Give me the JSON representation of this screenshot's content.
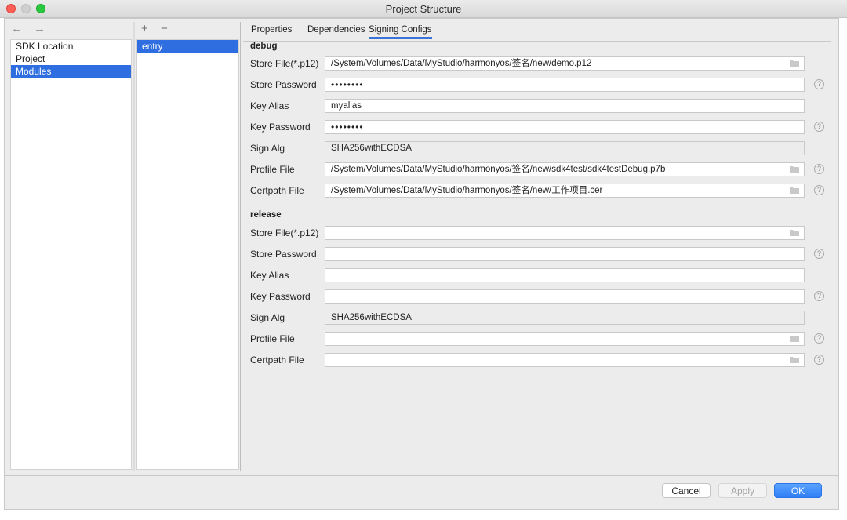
{
  "window": {
    "title": "Project Structure"
  },
  "nav": {
    "back": "←",
    "forward": "→"
  },
  "left_items": [
    "SDK Location",
    "Project",
    "Modules"
  ],
  "module_toolbar": {
    "add": "+",
    "remove": "−"
  },
  "modules": [
    "entry"
  ],
  "tabs": [
    "Properties",
    "Dependencies",
    "Signing Configs"
  ],
  "debug": {
    "heading": "debug",
    "store_file_label": "Store File(*.p12)",
    "store_file": "/System/Volumes/Data/MyStudio/harmonyos/签名/new/demo.p12",
    "store_password_label": "Store Password",
    "store_password": "••••••••",
    "key_alias_label": "Key Alias",
    "key_alias": "myalias",
    "key_password_label": "Key Password",
    "key_password": "••••••••",
    "sign_alg_label": "Sign Alg",
    "sign_alg": "SHA256withECDSA",
    "profile_file_label": "Profile File",
    "profile_file": "/System/Volumes/Data/MyStudio/harmonyos/签名/new/sdk4test/sdk4testDebug.p7b",
    "certpath_file_label": "Certpath File",
    "certpath_file": "/System/Volumes/Data/MyStudio/harmonyos/签名/new/工作项目.cer"
  },
  "release": {
    "heading": "release",
    "store_file_label": "Store File(*.p12)",
    "store_file": "",
    "store_password_label": "Store Password",
    "store_password": "",
    "key_alias_label": "Key Alias",
    "key_alias": "",
    "key_password_label": "Key Password",
    "key_password": "",
    "sign_alg_label": "Sign Alg",
    "sign_alg": "SHA256withECDSA",
    "profile_file_label": "Profile File",
    "profile_file": "",
    "certpath_file_label": "Certpath File",
    "certpath_file": ""
  },
  "help_glyph": "?",
  "buttons": {
    "cancel": "Cancel",
    "apply": "Apply",
    "ok": "OK"
  },
  "colors": {
    "selection": "#2e6ee0",
    "ok_button": "#2f7ef6",
    "close": "#fe5f57",
    "zoom": "#28c840"
  }
}
